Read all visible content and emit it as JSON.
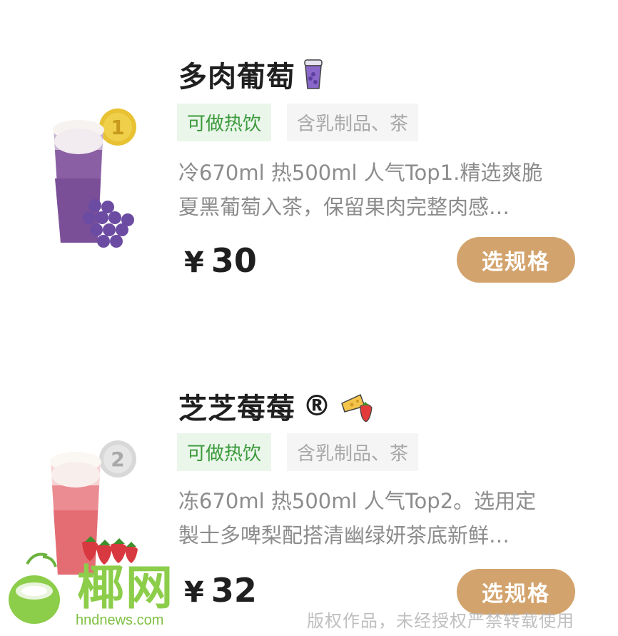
{
  "products": [
    {
      "name": "多肉葡萄",
      "icon": "grape-cup-icon",
      "rank": "1",
      "tags": {
        "hot": "可做热饮",
        "ingredients": "含乳制品、茶"
      },
      "desc_line1": "冷670ml 热500ml 人气Top1.精选爽脆",
      "desc_line2": "夏黑葡萄入茶，保留果肉完整肉感…",
      "currency": "¥",
      "price": "30",
      "button": "选规格"
    },
    {
      "name": "芝芝莓莓",
      "mark": "®",
      "icon": "cheese-strawberry-icon",
      "rank": "2",
      "tags": {
        "hot": "可做热饮",
        "ingredients": "含乳制品、茶"
      },
      "desc_line1": "冻670ml 热500ml 人气Top2。选用定",
      "desc_line2": "製士多啤梨配搭清幽绿妍茶底新鲜…",
      "currency": "¥",
      "price": "32",
      "button": "选规格"
    }
  ],
  "watermark": {
    "logo_text": "椰网",
    "url": "hndnews.com",
    "copyright": "版权作品，未经授权严禁转载使用"
  },
  "colors": {
    "button": "#d3a36d",
    "tag_green_bg": "#eaf6ea",
    "tag_green_text": "#3c9a3c",
    "tag_grey_bg": "#f5f5f5",
    "tag_grey_text": "#a8a8a8",
    "watermark_green": "#8ccd4a"
  }
}
